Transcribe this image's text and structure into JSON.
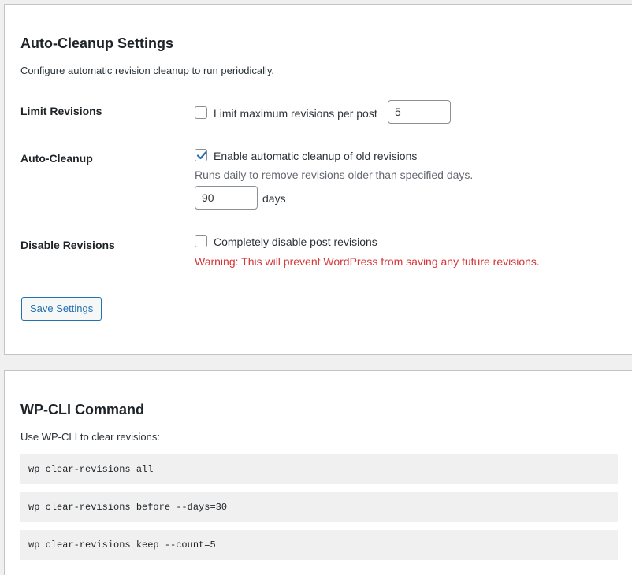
{
  "settings": {
    "title": "Auto-Cleanup Settings",
    "description": "Configure automatic revision cleanup to run periodically.",
    "limit_revisions": {
      "label": "Limit Revisions",
      "checkbox_label": "Limit maximum revisions per post",
      "checked": false,
      "value": "5"
    },
    "auto_cleanup": {
      "label": "Auto-Cleanup",
      "checkbox_label": "Enable automatic cleanup of old revisions",
      "checked": true,
      "hint": "Runs daily to remove revisions older than specified days.",
      "days_value": "90",
      "days_unit": "days"
    },
    "disable_revisions": {
      "label": "Disable Revisions",
      "checkbox_label": "Completely disable post revisions",
      "checked": false,
      "warning": "Warning: This will prevent WordPress from saving any future revisions."
    },
    "save_button": "Save Settings"
  },
  "cli": {
    "title": "WP-CLI Command",
    "description": "Use WP-CLI to clear revisions:",
    "commands": [
      "wp clear-revisions all",
      "wp clear-revisions before --days=30",
      "wp clear-revisions keep --count=5"
    ]
  },
  "colors": {
    "accent": "#2271b1",
    "warning": "#d63638",
    "code_bg": "#f0f0f1"
  },
  "icons": {
    "checkmark": "checkmark-icon"
  }
}
